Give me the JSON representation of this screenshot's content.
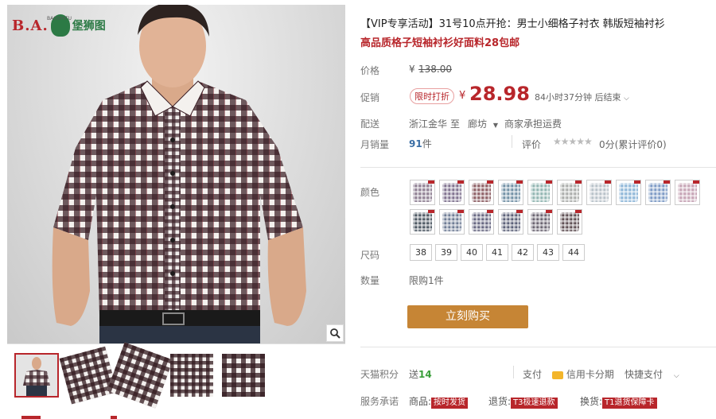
{
  "brand": {
    "logo_text": "B.A.",
    "logo_cn": "堡狮图",
    "logo_sub": "BAOSHITU"
  },
  "colors": {
    "accent_red": "#b8262b",
    "buy_button": "#c68535"
  },
  "title": {
    "line1": "【VIP专享活动】31号10点开抢：男士小细格子衬衣 韩版短袖衬衫",
    "line2": "高品质格子短袖衬衫好面料28包邮"
  },
  "price": {
    "label": "价格",
    "currency": "¥",
    "old_value": "138.00"
  },
  "promo": {
    "label": "促销",
    "tag": "限时打折",
    "currency": "¥",
    "value": "28.98",
    "countdown": "84小时37分钟 后结束"
  },
  "shipping": {
    "label": "配送",
    "from": "浙江金华",
    "arrow": "至",
    "to": "廊坊",
    "note": "商家承担运费"
  },
  "sales": {
    "label": "月销量",
    "count": "91",
    "unit": "件",
    "rating_label": "评价",
    "stars": "★★★★★",
    "rating_text": "0分(累计评价0)"
  },
  "color_label": "颜色",
  "color_swatches": [
    "#8a7a8e",
    "#7d6f8c",
    "#8a5a60",
    "#6f8ea3",
    "#8fb4b0",
    "#a8aaa8",
    "#b7c0c8",
    "#8ab4d6",
    "#7a98c4",
    "#c4a0b2",
    "#4a5560",
    "#6f7c95",
    "#656580",
    "#5c6078",
    "#6a6470",
    "#5e4e52"
  ],
  "size": {
    "label": "尺码",
    "options": [
      "38",
      "39",
      "40",
      "41",
      "42",
      "43",
      "44"
    ]
  },
  "quantity": {
    "label": "数量",
    "limit": "限购1件"
  },
  "buy_button": "立刻购买",
  "points": {
    "label": "天猫积分",
    "prefix": "送",
    "value": "14"
  },
  "payment": {
    "label": "支付",
    "card": "信用卡分期",
    "express": "快捷支付"
  },
  "service": {
    "label": "服务承诺",
    "item1_pre": "商品:",
    "item1_badge": "按时发货",
    "item2_pre": "退货:",
    "item2_badge": "T3极速退款",
    "item3_pre": "换货:",
    "item3_badge": "T1退货保障卡"
  }
}
